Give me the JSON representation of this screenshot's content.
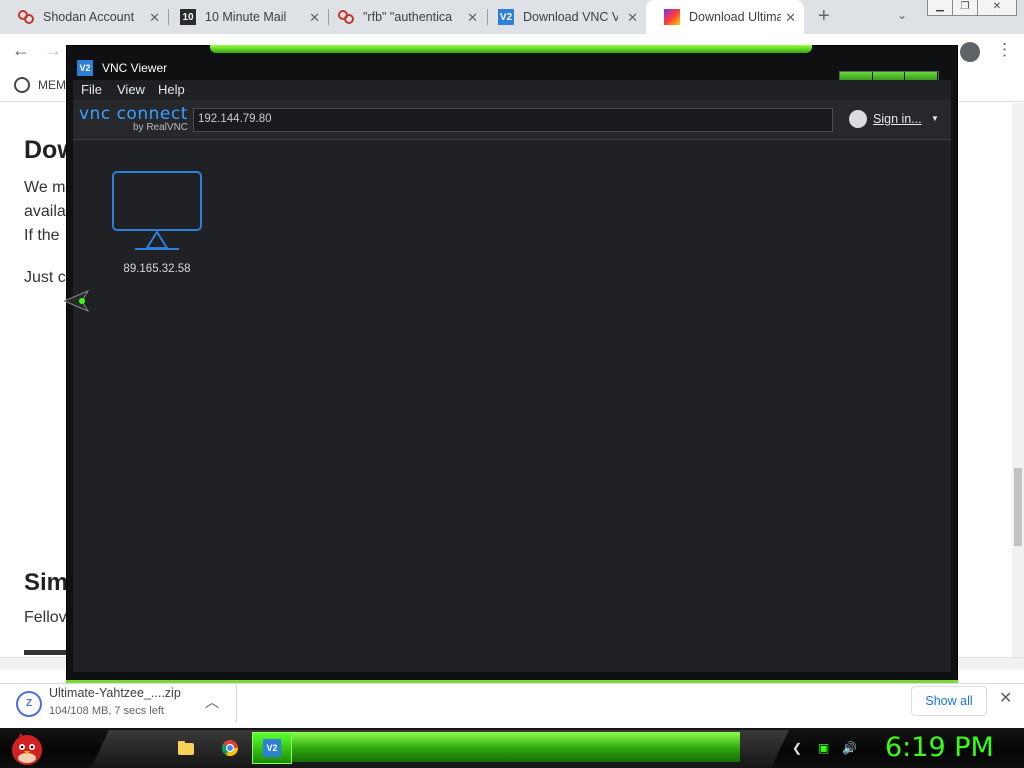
{
  "browser": {
    "tabs": [
      {
        "title": "Shodan Account",
        "favicon": "shodan-icon",
        "active": false
      },
      {
        "title": "10 Minute Mail",
        "favicon": "10-minute-mail-icon",
        "favicon_text": "10",
        "active": false
      },
      {
        "title": "\"rfb\" \"authentica",
        "favicon": "shodan-icon",
        "active": false
      },
      {
        "title": "Download VNC V",
        "favicon": "vnc-icon",
        "favicon_text": "V2",
        "active": false
      },
      {
        "title": "Download Ultima",
        "favicon": "page-icon",
        "active": true
      }
    ],
    "bookmark_label": "MEM"
  },
  "page": {
    "heading": "Dow",
    "lines": [
      "We m",
      "availa",
      "If the",
      "Just c"
    ],
    "heading2": "Sim",
    "line2": "Fellov"
  },
  "vnc": {
    "window_title": "VNC Viewer",
    "logo_text": "V2",
    "menu": [
      "File",
      "View",
      "Help"
    ],
    "brand": "vnc connect",
    "brand_by": "by RealVNC",
    "address": "192.144.79.80",
    "sign_in": "Sign in...",
    "computers": [
      {
        "label": "89.165.32.58",
        "icon": "monitor-icon"
      }
    ]
  },
  "download": {
    "filename": "Ultimate-Yahtzee_....zip",
    "status": "104/108 MB, 7 secs left",
    "show_all": "Show all"
  },
  "taskbar": {
    "clock": "6:19 PM",
    "start_icon": "angry-bird-icon",
    "apps": [
      "folder-icon",
      "chrome-icon",
      "vnc-icon"
    ]
  },
  "colors": {
    "accent_green": "#39ff14",
    "vnc_blue": "#2d7fd9",
    "chrome_link": "#1a73e8"
  }
}
